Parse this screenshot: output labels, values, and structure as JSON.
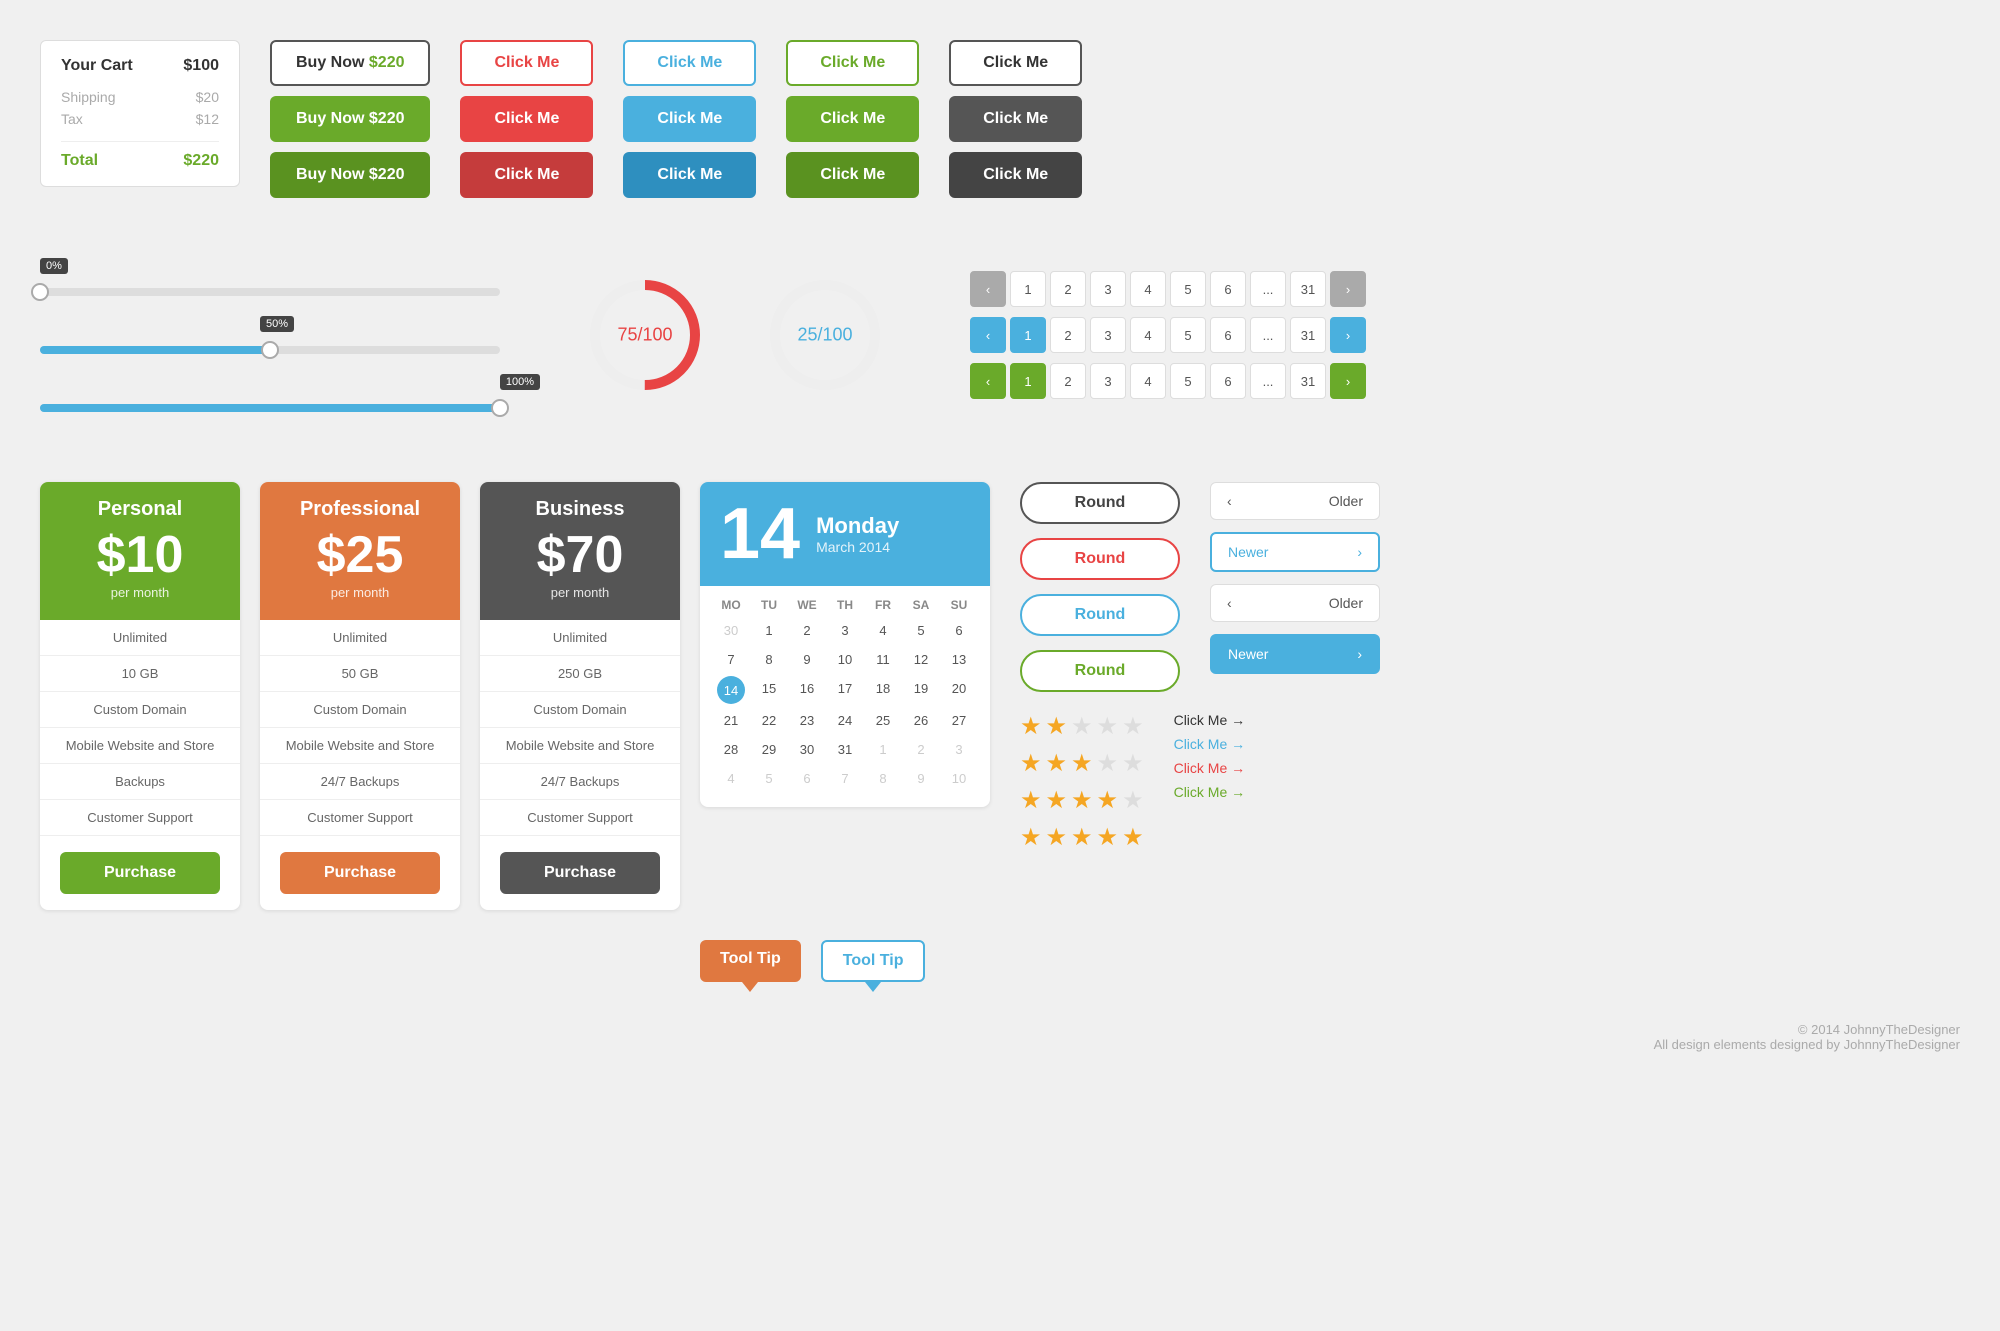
{
  "cart": {
    "title": "Your Cart",
    "cart_amount": "$100",
    "shipping_label": "Shipping",
    "shipping_amount": "$20",
    "tax_label": "Tax",
    "tax_amount": "$12",
    "total_label": "Total",
    "total_amount": "$220"
  },
  "buy_buttons": {
    "label": "Buy Now",
    "price": "$220"
  },
  "buttons": {
    "click_me": "Click Me",
    "purchase": "Purchase",
    "round": "Round",
    "older": "Older",
    "newer": "Newer"
  },
  "sliders": {
    "s1_pct": "0%",
    "s2_pct": "50%",
    "s3_pct": "100%"
  },
  "charts": {
    "donut1": "75/100",
    "donut2": "25/100"
  },
  "calendar": {
    "day": "14",
    "weekday": "Monday",
    "month": "March 2014",
    "dow": [
      "MO",
      "TU",
      "WE",
      "TH",
      "FR",
      "SA",
      "SU"
    ],
    "weeks": [
      [
        "30",
        "1",
        "2",
        "3",
        "4",
        "5",
        "6"
      ],
      [
        "7",
        "8",
        "9",
        "10",
        "11",
        "12",
        "13"
      ],
      [
        "14",
        "15",
        "16",
        "17",
        "18",
        "19",
        "20"
      ],
      [
        "21",
        "22",
        "23",
        "24",
        "25",
        "26",
        "27"
      ],
      [
        "28",
        "29",
        "30",
        "31",
        "1",
        "2",
        "3"
      ],
      [
        "4",
        "5",
        "6",
        "7",
        "8",
        "9",
        "10"
      ]
    ]
  },
  "pricing": [
    {
      "plan": "Personal",
      "price": "$10",
      "period": "per month",
      "features": [
        "Unlimited",
        "10 GB",
        "Custom Domain",
        "Mobile Website and Store",
        "Backups",
        "Customer Support"
      ],
      "btn_color": "green"
    },
    {
      "plan": "Professional",
      "price": "$25",
      "period": "per month",
      "features": [
        "Unlimited",
        "50 GB",
        "Custom Domain",
        "Mobile Website and Store",
        "24/7 Backups",
        "Customer Support"
      ],
      "btn_color": "orange"
    },
    {
      "plan": "Business",
      "price": "$70",
      "period": "per month",
      "features": [
        "Unlimited",
        "250 GB",
        "Custom Domain",
        "Mobile Website and Store",
        "24/7 Backups",
        "Customer Support"
      ],
      "btn_color": "dark"
    }
  ],
  "tooltips": {
    "t1": "Tool Tip",
    "t2": "Tool Tip"
  },
  "links": [
    {
      "text": "Click Me →",
      "color": "black"
    },
    {
      "text": "Click Me →",
      "color": "blue"
    },
    {
      "text": "Click Me →",
      "color": "red"
    },
    {
      "text": "Click Me →",
      "color": "green"
    }
  ],
  "stars": [
    {
      "filled": 2,
      "empty": 3
    },
    {
      "filled": 3,
      "empty": 2
    },
    {
      "filled": 4,
      "empty": 1
    },
    {
      "filled": 5,
      "empty": 0
    }
  ],
  "footer": {
    "line1": "© 2014 JohnnyTheDesigner",
    "line2": "All design elements designed by JohnnyTheDesigner"
  },
  "pagination": {
    "pages": [
      "1",
      "2",
      "3",
      "4",
      "5",
      "6",
      "...",
      "31"
    ]
  }
}
